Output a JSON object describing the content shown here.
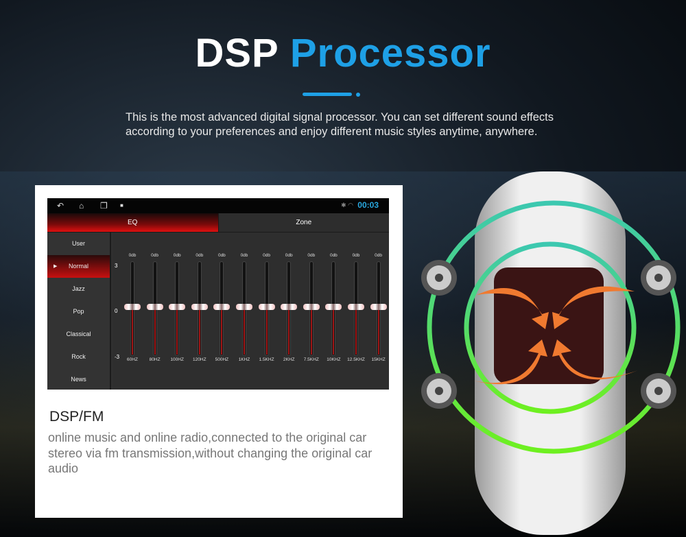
{
  "header": {
    "title_white": "DSP",
    "title_blue": "Processor",
    "description": "This is the most advanced digital signal processor. You can set different sound effects according to your preferences and enjoy different music styles anytime, anywhere."
  },
  "screen": {
    "clock": "00:03",
    "tabs": [
      "EQ",
      "Zone"
    ],
    "presets": [
      "User",
      "Normal",
      "Jazz",
      "Pop",
      "Classical",
      "Rock",
      "News"
    ],
    "selected_preset": "Normal",
    "scale": [
      "3",
      "0",
      "-3"
    ],
    "bands": [
      {
        "freq": "60HZ",
        "gain": "0db",
        "value": 0
      },
      {
        "freq": "80HZ",
        "gain": "0db",
        "value": 0
      },
      {
        "freq": "100HZ",
        "gain": "0db",
        "value": 0
      },
      {
        "freq": "120HZ",
        "gain": "0db",
        "value": 0
      },
      {
        "freq": "500HZ",
        "gain": "0db",
        "value": 0
      },
      {
        "freq": "1KHZ",
        "gain": "0db",
        "value": 0
      },
      {
        "freq": "1.5KHZ",
        "gain": "0db",
        "value": 0
      },
      {
        "freq": "2KHZ",
        "gain": "0db",
        "value": 0
      },
      {
        "freq": "7.5KHZ",
        "gain": "0db",
        "value": 0
      },
      {
        "freq": "10KHZ",
        "gain": "0db",
        "value": 0
      },
      {
        "freq": "12.5KHZ",
        "gain": "0db",
        "value": 0
      },
      {
        "freq": "15KHZ",
        "gain": "0db",
        "value": 0
      }
    ]
  },
  "card": {
    "heading": "DSP/FM",
    "text": "online music and online radio,connected to the original car stereo via fm transmission,without changing the original car audio"
  },
  "colors": {
    "accent": "#1ea0e6",
    "eq_red": "#e01010",
    "clock": "#29a8e0"
  }
}
